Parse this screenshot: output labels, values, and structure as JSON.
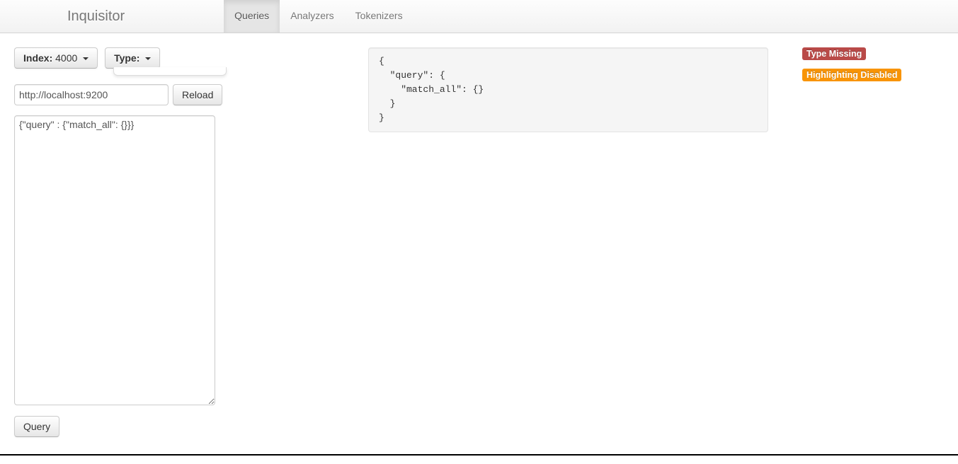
{
  "brand": "Inquisitor",
  "tabs": {
    "queries": "Queries",
    "analyzers": "Analyzers",
    "tokenizers": "Tokenizers"
  },
  "controls": {
    "index_label": "Index:",
    "index_value": " 4000 ",
    "type_label": "Type:",
    "type_value": " ",
    "host_value": "http://localhost:9200",
    "reload": "Reload",
    "query_btn": "Query"
  },
  "query_input": "{\"query\" : {\"match_all\": {}}}",
  "query_output": "{\n  \"query\": {\n    \"match_all\": {}\n  }\n}",
  "badges": {
    "type_missing": "Type Missing",
    "highlighting_disabled": "Highlighting Disabled"
  }
}
